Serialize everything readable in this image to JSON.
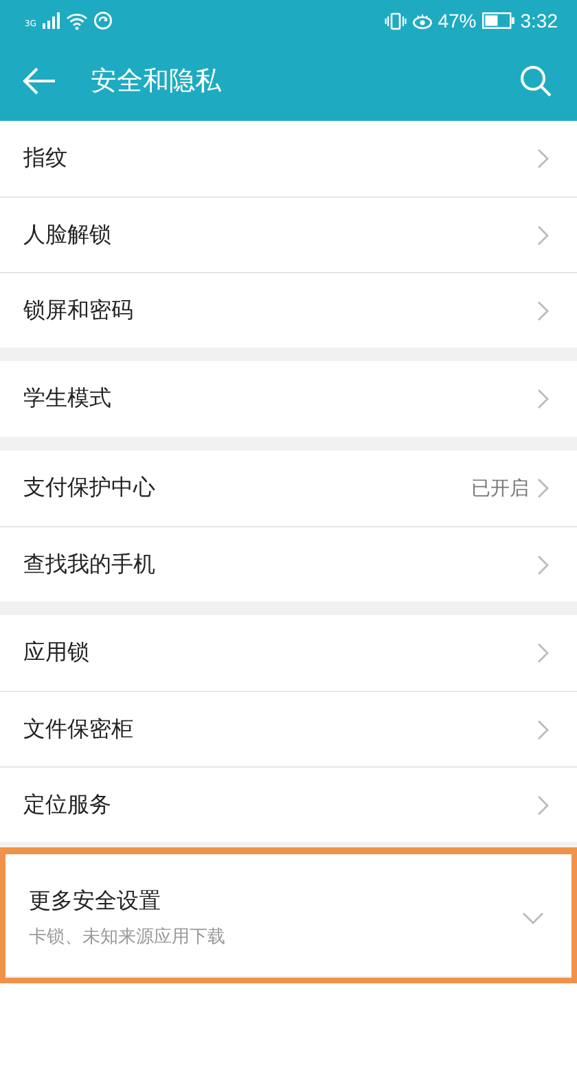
{
  "status_bar": {
    "network": "3G",
    "battery": "47%",
    "time": "3:32"
  },
  "header": {
    "title": "安全和隐私"
  },
  "groups": [
    {
      "items": [
        {
          "kind": "link",
          "label": "指纹"
        },
        {
          "kind": "link",
          "label": "人脸解锁"
        },
        {
          "kind": "link",
          "label": "锁屏和密码"
        }
      ]
    },
    {
      "items": [
        {
          "kind": "link",
          "label": "学生模式"
        }
      ]
    },
    {
      "items": [
        {
          "kind": "link",
          "label": "支付保护中心",
          "value": "已开启"
        },
        {
          "kind": "link",
          "label": "查找我的手机"
        }
      ]
    },
    {
      "items": [
        {
          "kind": "link",
          "label": "应用锁"
        },
        {
          "kind": "link",
          "label": "文件保密柜"
        },
        {
          "kind": "link",
          "label": "定位服务"
        }
      ]
    },
    {
      "highlighted": true,
      "items": [
        {
          "kind": "expand",
          "label": "更多安全设置",
          "subtitle": "卡锁、未知来源应用下载",
          "expanded": false
        }
      ]
    }
  ]
}
